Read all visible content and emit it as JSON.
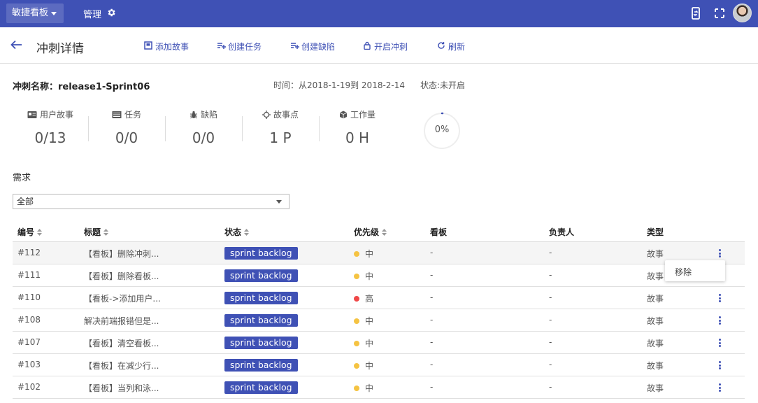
{
  "topbar": {
    "app_menu_label": "敏捷看板",
    "manage_label": "管理"
  },
  "toolbar": {
    "title": "冲刺详情",
    "actions": [
      {
        "label": "添加故事",
        "icon": "add-story-icon"
      },
      {
        "label": "创建任务",
        "icon": "playlist-add-icon"
      },
      {
        "label": "创建缺陷",
        "icon": "playlist-add-icon"
      },
      {
        "label": "开启冲刺",
        "icon": "lock-icon"
      },
      {
        "label": "刷新",
        "icon": "refresh-icon"
      }
    ]
  },
  "sprint": {
    "name_label": "冲刺名称：release1-Sprint06",
    "time": "时间：从2018-1-19到 2018-2-14",
    "status": "状态:未开启",
    "progress_percent": 0,
    "progress_label": "0%"
  },
  "stats": [
    {
      "label": "用户故事",
      "value": "0/13",
      "icon": "card-icon"
    },
    {
      "label": "任务",
      "value": "0/0",
      "icon": "task-list-icon"
    },
    {
      "label": "缺陷",
      "value": "0/0",
      "icon": "bug-icon"
    },
    {
      "label": "故事点",
      "value": "1 P",
      "icon": "crosshair-icon"
    },
    {
      "label": "工作量",
      "value": "0 H",
      "icon": "cube-icon"
    }
  ],
  "requirements": {
    "section_title": "需求",
    "filter_value": "全部"
  },
  "table": {
    "headers": {
      "id": "编号",
      "title": "标题",
      "status": "状态",
      "priority": "优先级",
      "board": "看板",
      "owner": "负责人",
      "type": "类型"
    },
    "rows": [
      {
        "id": "#112",
        "title": "【看板】删除冲刺...",
        "status": "sprint backlog",
        "priority": "中",
        "priority_color": "#f5c342",
        "board": "-",
        "owner": "-",
        "type": "故事"
      },
      {
        "id": "#111",
        "title": "【看板】删除看板...",
        "status": "sprint backlog",
        "priority": "中",
        "priority_color": "#f5c342",
        "board": "-",
        "owner": "-",
        "type": "故事"
      },
      {
        "id": "#110",
        "title": "【看板->添加用户...",
        "status": "sprint backlog",
        "priority": "高",
        "priority_color": "#f04848",
        "board": "-",
        "owner": "-",
        "type": "故事"
      },
      {
        "id": "#108",
        "title": "解决前端报错但是...",
        "status": "sprint backlog",
        "priority": "中",
        "priority_color": "#f5c342",
        "board": "-",
        "owner": "-",
        "type": "故事"
      },
      {
        "id": "#107",
        "title": "【看板】清空看板...",
        "status": "sprint backlog",
        "priority": "中",
        "priority_color": "#f5c342",
        "board": "-",
        "owner": "-",
        "type": "故事"
      },
      {
        "id": "#103",
        "title": "【看板】在减少行...",
        "status": "sprint backlog",
        "priority": "中",
        "priority_color": "#f5c342",
        "board": "-",
        "owner": "-",
        "type": "故事"
      },
      {
        "id": "#102",
        "title": "【看板】当列和泳...",
        "status": "sprint backlog",
        "priority": "中",
        "priority_color": "#f5c342",
        "board": "-",
        "owner": "-",
        "type": "故事"
      }
    ]
  },
  "row_menu": {
    "remove_label": "移除"
  },
  "colors": {
    "primary": "#3f51b5",
    "priority_medium": "#f5c342",
    "priority_high": "#f04848"
  }
}
